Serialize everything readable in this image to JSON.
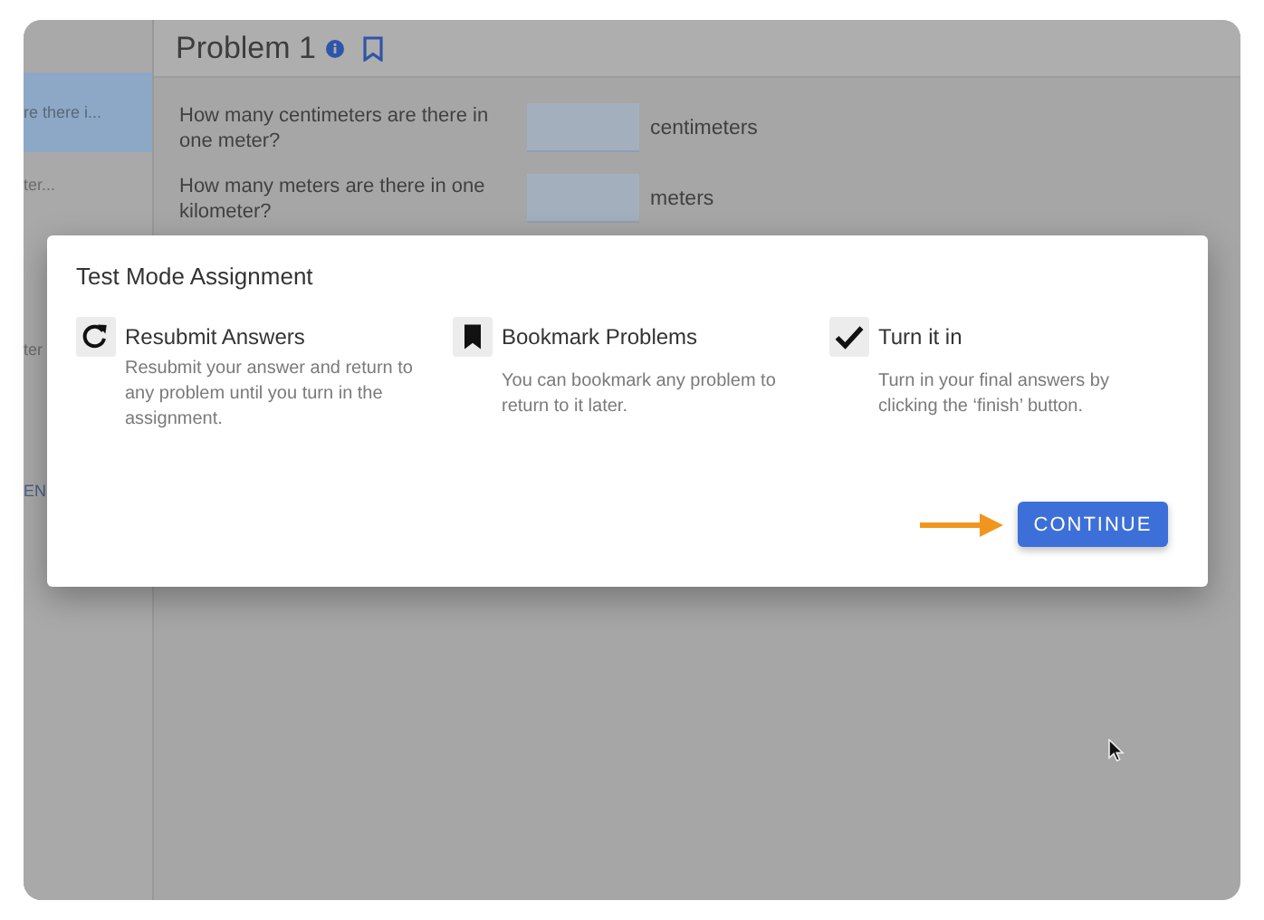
{
  "sidebar": {
    "items": [
      {
        "label": "re there i...",
        "selected": true
      },
      {
        "label": "ter...",
        "selected": false
      },
      {
        "label": "ter",
        "selected": false
      }
    ],
    "link": "EN"
  },
  "problem": {
    "title": "Problem 1",
    "questions": [
      {
        "text": "How many centimeters are there in one meter?",
        "unit": "centimeters"
      },
      {
        "text": "How many meters are there in one kilometer?",
        "unit": "meters"
      }
    ]
  },
  "dialog": {
    "title": "Test Mode Assignment",
    "features": [
      {
        "kind": "resubmit",
        "title": "Resubmit Answers",
        "description": "Resubmit your answer and return to any problem until you turn in the assignment."
      },
      {
        "kind": "bookmark",
        "title": "Bookmark Problems",
        "description": "You can bookmark any problem to return to it later."
      },
      {
        "kind": "turn-in",
        "title": "Turn it in",
        "description": "Turn in your final answers by clicking the ‘finish’ button."
      }
    ],
    "button": "CONTINUE"
  }
}
